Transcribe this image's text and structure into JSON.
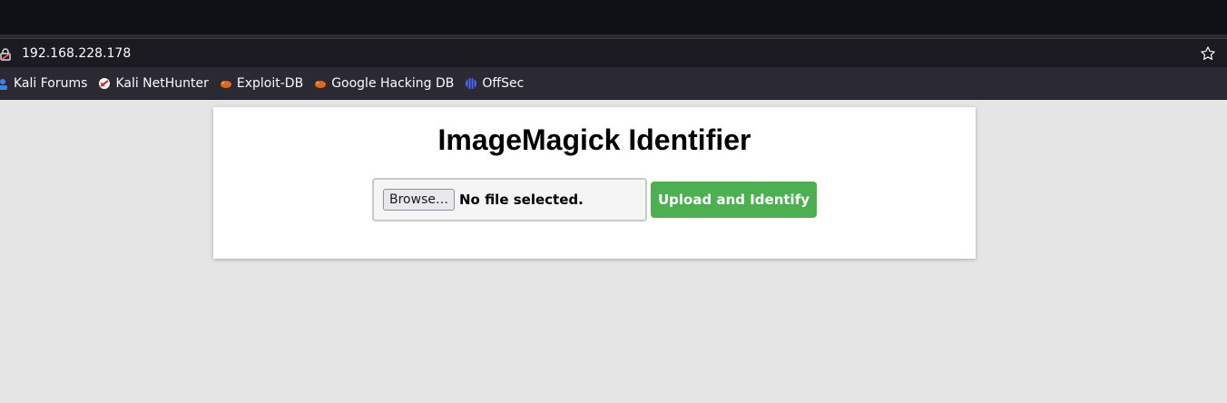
{
  "browser": {
    "url": "192.168.228.178",
    "bookmarks": [
      {
        "label": "Kali Forums",
        "icon": "kali-forums-icon"
      },
      {
        "label": "Kali NetHunter",
        "icon": "nethunter-icon"
      },
      {
        "label": "Exploit-DB",
        "icon": "exploit-db-icon"
      },
      {
        "label": "Google Hacking DB",
        "icon": "ghdb-icon"
      },
      {
        "label": "OffSec",
        "icon": "offsec-icon"
      }
    ]
  },
  "page": {
    "title": "ImageMagick Identifier",
    "browse_label": "Browse…",
    "file_status": "No file selected.",
    "upload_label": "Upload and Identify"
  },
  "colors": {
    "upload_button": "#4caf50",
    "toolbar": "#2b2a33",
    "titlebar": "#0f1117"
  }
}
